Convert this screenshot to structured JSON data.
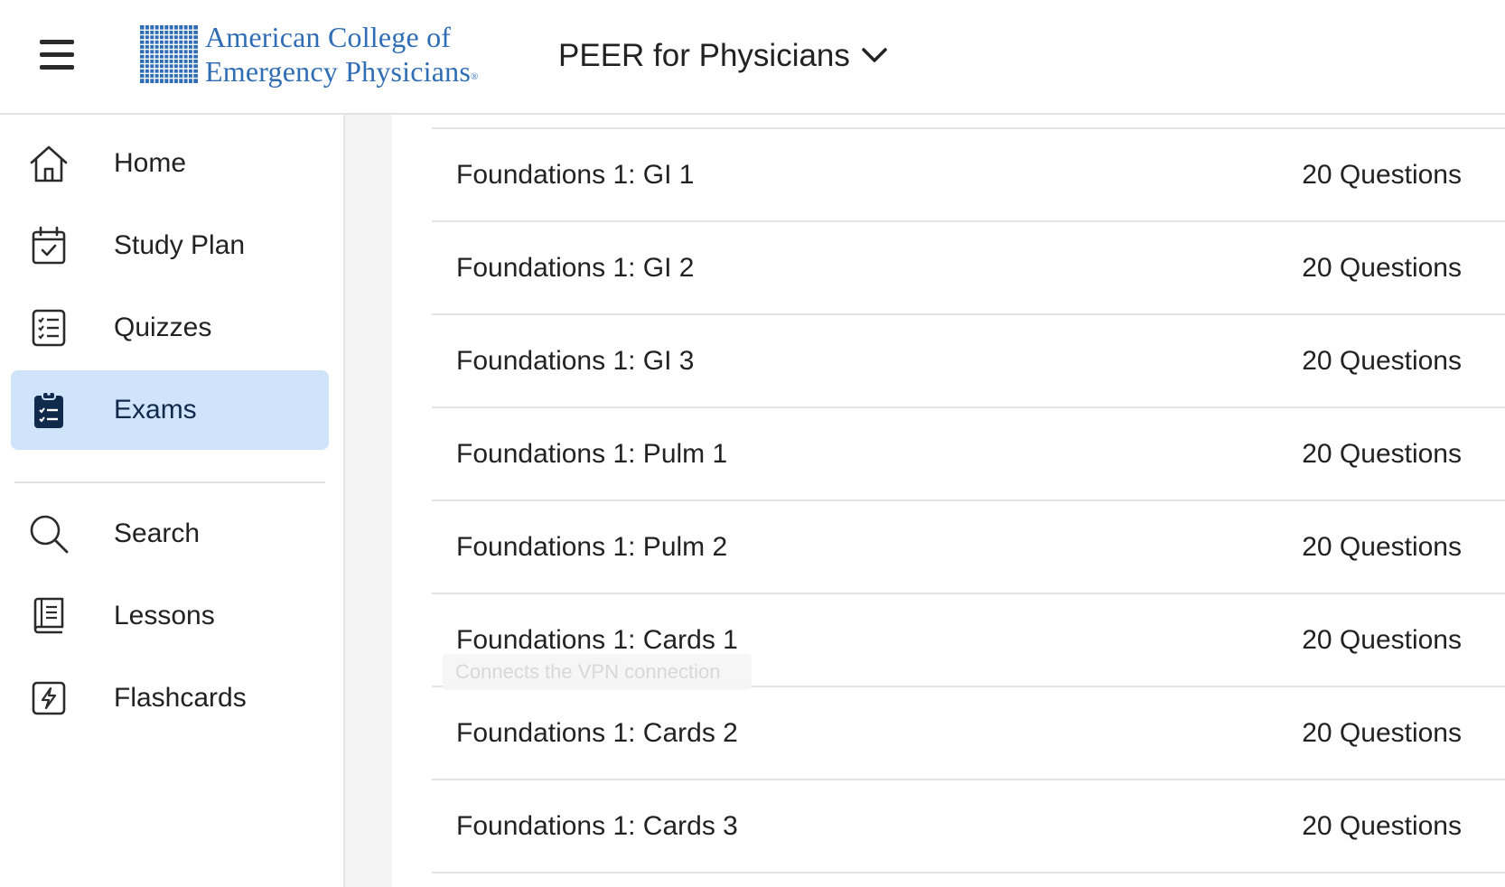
{
  "header": {
    "logo_line1": "American College of",
    "logo_line2": "Emergency Physicians",
    "logo_mark": "®",
    "product_title": "PEER for Physicians"
  },
  "sidebar": {
    "items": [
      {
        "label": "Home",
        "icon": "home-icon"
      },
      {
        "label": "Study Plan",
        "icon": "calendar-check-icon"
      },
      {
        "label": "Quizzes",
        "icon": "checklist-icon"
      },
      {
        "label": "Exams",
        "icon": "clipboard-check-icon",
        "active": true
      },
      {
        "label": "Search",
        "icon": "search-icon"
      },
      {
        "label": "Lessons",
        "icon": "book-icon"
      },
      {
        "label": "Flashcards",
        "icon": "flashcard-bolt-icon"
      }
    ]
  },
  "exams": [
    {
      "title": "Foundations 1: GI 1",
      "count": "20 Questions"
    },
    {
      "title": "Foundations 1: GI 2",
      "count": "20 Questions"
    },
    {
      "title": "Foundations 1: GI 3",
      "count": "20 Questions"
    },
    {
      "title": "Foundations 1: Pulm 1",
      "count": "20 Questions"
    },
    {
      "title": "Foundations 1: Pulm 2",
      "count": "20 Questions"
    },
    {
      "title": "Foundations 1: Cards 1",
      "count": "20 Questions"
    },
    {
      "title": "Foundations 1: Cards 2",
      "count": "20 Questions"
    },
    {
      "title": "Foundations 1: Cards 3",
      "count": "20 Questions"
    }
  ],
  "tooltip": "Connects the VPN connection",
  "colors": {
    "brand_blue": "#2f6db5",
    "active_bg": "#cfe3fb",
    "active_icon": "#0f2a4a"
  }
}
